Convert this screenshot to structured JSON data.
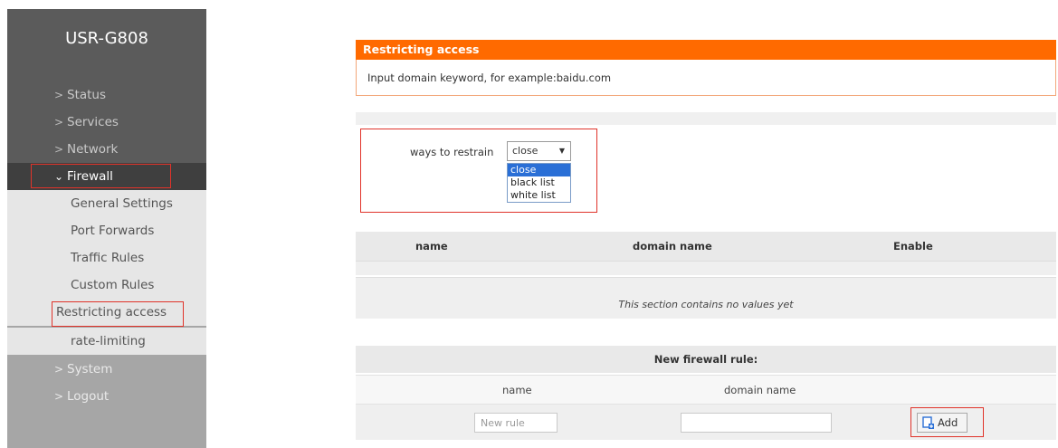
{
  "app": {
    "brand": "USR-G808"
  },
  "sidebar": {
    "items": [
      {
        "label": "Status",
        "type": "section"
      },
      {
        "label": "Services",
        "type": "section"
      },
      {
        "label": "Network",
        "type": "section"
      },
      {
        "label": "Firewall",
        "type": "section-open"
      },
      {
        "label": "General Settings",
        "type": "sub"
      },
      {
        "label": "Port Forwards",
        "type": "sub"
      },
      {
        "label": "Traffic Rules",
        "type": "sub"
      },
      {
        "label": "Custom Rules",
        "type": "sub"
      },
      {
        "label": "Restricting access",
        "type": "sub"
      },
      {
        "label": "rate-limiting",
        "type": "sub"
      },
      {
        "label": "System",
        "type": "section"
      },
      {
        "label": "Logout",
        "type": "section"
      }
    ]
  },
  "main": {
    "panel": {
      "title": "Restricting access",
      "hint": "Input domain keyword, for example:baidu.com"
    },
    "restrain": {
      "label": "ways to restrain",
      "selected": "close",
      "options": [
        "close",
        "black list",
        "white list"
      ]
    },
    "table": {
      "headers": {
        "name": "name",
        "domain": "domain name",
        "enable": "Enable"
      },
      "empty_message": "This section contains no values yet"
    },
    "new_rule": {
      "title": "New firewall rule:",
      "col_name": "name",
      "col_domain": "domain name",
      "name_placeholder": "New rule",
      "domain_value": "",
      "add_label": "Add"
    }
  },
  "colors": {
    "accent": "#ff6a00",
    "highlight_box": "#e0332a",
    "sidebar_dark": "#5b5b5b",
    "sidebar_light": "#a6a6a6"
  }
}
